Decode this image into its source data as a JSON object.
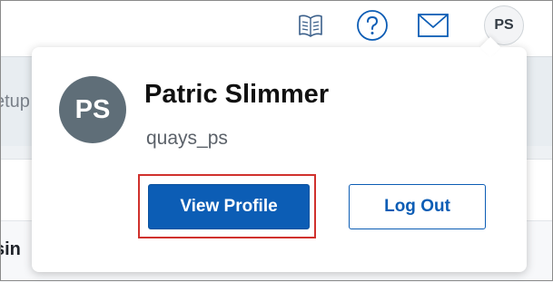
{
  "header": {
    "avatar_initials": "PS",
    "icons": [
      "book-icon",
      "help-icon",
      "mail-icon"
    ]
  },
  "background": {
    "partial_text_1": "etup",
    "partial_text_2": "sin"
  },
  "profile_popover": {
    "avatar_initials": "PS",
    "full_name": "Patric Slimmer",
    "username": "quays_ps",
    "view_profile_label": "View Profile",
    "logout_label": "Log Out"
  },
  "colors": {
    "primary": "#0c5db5",
    "avatar_bg": "#5f6e78",
    "highlight": "#d0312d"
  }
}
